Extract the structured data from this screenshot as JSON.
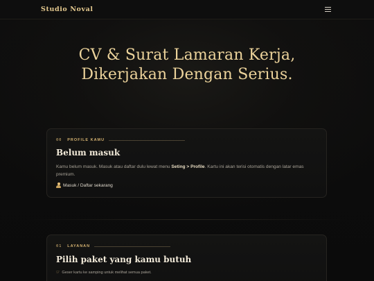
{
  "header": {
    "brand": "Studio Noval",
    "menu_icon": "hamburger-icon"
  },
  "hero": {
    "line1": "CV & Surat Lamaran Kerja,",
    "line2": "Dikerjakan Dengan Serius."
  },
  "profile_card": {
    "number": "00",
    "eyebrow": "PROFILE KAMU",
    "title": "Belum masuk",
    "text_before": "Kamu belum masuk. Masuk atau daftar dulu lewat menu ",
    "text_bold": "Seting > Profile",
    "text_after": ". Kartu ini akan terisi otomatis dengan latar emas premium.",
    "link_icon": "user-icon",
    "link_label": "Masuk / Daftar sekarang"
  },
  "services_card": {
    "number": "01",
    "eyebrow": "LAYANAN",
    "title": "Pilih paket yang kamu butuh",
    "hint_icon": "pointing-hand-icon",
    "hint": "Geser kartu ke samping untuk melihat semua paket."
  },
  "colors": {
    "accent": "#e4c98f",
    "background": "#0b0b0b",
    "card": "#121212"
  }
}
